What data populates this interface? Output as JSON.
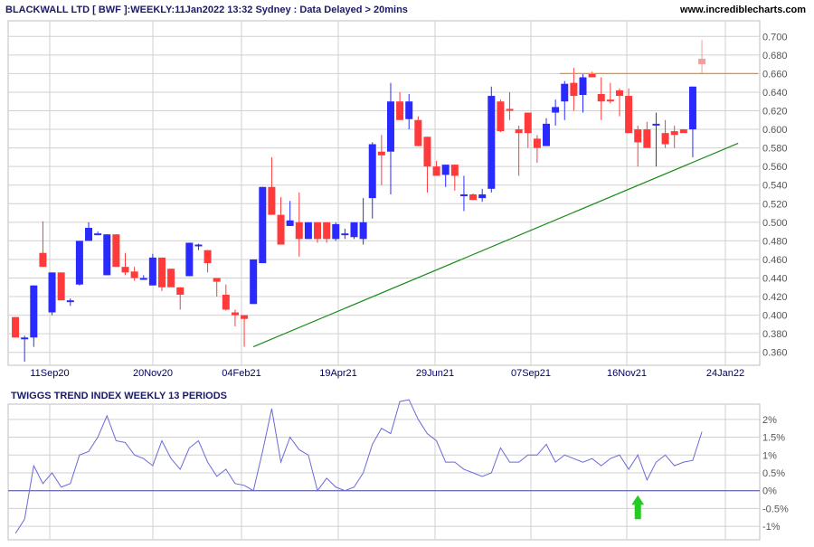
{
  "header": {
    "title": "BLACKWALL LTD [ BWF ]:WEEKLY:11Jan2022 13:32 Sydney : Data Delayed > 20mins",
    "site": "www.incrediblecharts.com"
  },
  "colors": {
    "background": "#ffffff",
    "grid": "#d0d0d0",
    "up_candle": "#2a2aff",
    "down_candle": "#ff3a3a",
    "projected_candle": "#f0a0a0",
    "resistance_line": "#ff8c00",
    "trend_line": "#1a8c1a",
    "indicator_line": "#6a6ad8",
    "zero_line": "#4a4aa0",
    "arrow": "#22cc22",
    "axis_text": "#555555"
  },
  "chart_data": [
    {
      "type": "candlestick",
      "x_tick_labels": [
        "11Sep20",
        "20Nov20",
        "04Feb21",
        "19Apr21",
        "29Jun21",
        "07Sep21",
        "16Nov21",
        "24Jan22"
      ],
      "y_tick_labels": [
        "0.700",
        "0.680",
        "0.660",
        "0.640",
        "0.620",
        "0.600",
        "0.580",
        "0.560",
        "0.540",
        "0.520",
        "0.500",
        "0.480",
        "0.460",
        "0.440",
        "0.420",
        "0.400",
        "0.380",
        "0.360"
      ],
      "ylim": [
        0.35,
        0.71
      ],
      "grid": true,
      "candles": [
        {
          "o": 0.398,
          "h": 0.398,
          "l": 0.376,
          "c": 0.376
        },
        {
          "o": 0.376,
          "h": 0.378,
          "l": 0.35,
          "c": 0.376
        },
        {
          "o": 0.376,
          "h": 0.432,
          "l": 0.366,
          "c": 0.432
        },
        {
          "o": 0.467,
          "h": 0.501,
          "l": 0.452,
          "c": 0.452
        },
        {
          "o": 0.403,
          "h": 0.446,
          "l": 0.4,
          "c": 0.446
        },
        {
          "o": 0.446,
          "h": 0.446,
          "l": 0.416,
          "c": 0.416
        },
        {
          "o": 0.416,
          "h": 0.418,
          "l": 0.41,
          "c": 0.416
        },
        {
          "o": 0.433,
          "h": 0.48,
          "l": 0.432,
          "c": 0.48
        },
        {
          "o": 0.48,
          "h": 0.5,
          "l": 0.48,
          "c": 0.494
        },
        {
          "o": 0.488,
          "h": 0.49,
          "l": 0.488,
          "c": 0.488
        },
        {
          "o": 0.443,
          "h": 0.487,
          "l": 0.443,
          "c": 0.487
        },
        {
          "o": 0.487,
          "h": 0.487,
          "l": 0.452,
          "c": 0.452
        },
        {
          "o": 0.452,
          "h": 0.467,
          "l": 0.443,
          "c": 0.446
        },
        {
          "o": 0.447,
          "h": 0.452,
          "l": 0.437,
          "c": 0.44
        },
        {
          "o": 0.44,
          "h": 0.443,
          "l": 0.44,
          "c": 0.44
        },
        {
          "o": 0.432,
          "h": 0.466,
          "l": 0.432,
          "c": 0.462
        },
        {
          "o": 0.462,
          "h": 0.462,
          "l": 0.426,
          "c": 0.43
        },
        {
          "o": 0.45,
          "h": 0.45,
          "l": 0.43,
          "c": 0.43
        },
        {
          "o": 0.43,
          "h": 0.43,
          "l": 0.406,
          "c": 0.422
        },
        {
          "o": 0.442,
          "h": 0.478,
          "l": 0.442,
          "c": 0.478
        },
        {
          "o": 0.476,
          "h": 0.477,
          "l": 0.47,
          "c": 0.476
        },
        {
          "o": 0.47,
          "h": 0.47,
          "l": 0.446,
          "c": 0.456
        },
        {
          "o": 0.44,
          "h": 0.44,
          "l": 0.42,
          "c": 0.436
        },
        {
          "o": 0.422,
          "h": 0.433,
          "l": 0.405,
          "c": 0.406
        },
        {
          "o": 0.403,
          "h": 0.406,
          "l": 0.388,
          "c": 0.4
        },
        {
          "o": 0.4,
          "h": 0.4,
          "l": 0.366,
          "c": 0.396
        },
        {
          "o": 0.412,
          "h": 0.46,
          "l": 0.412,
          "c": 0.46
        },
        {
          "o": 0.456,
          "h": 0.538,
          "l": 0.456,
          "c": 0.538
        },
        {
          "o": 0.538,
          "h": 0.57,
          "l": 0.508,
          "c": 0.508
        },
        {
          "o": 0.508,
          "h": 0.527,
          "l": 0.476,
          "c": 0.476
        },
        {
          "o": 0.496,
          "h": 0.523,
          "l": 0.496,
          "c": 0.502
        },
        {
          "o": 0.5,
          "h": 0.532,
          "l": 0.463,
          "c": 0.482
        },
        {
          "o": 0.482,
          "h": 0.5,
          "l": 0.482,
          "c": 0.5
        },
        {
          "o": 0.5,
          "h": 0.5,
          "l": 0.478,
          "c": 0.482
        },
        {
          "o": 0.5,
          "h": 0.5,
          "l": 0.478,
          "c": 0.482
        },
        {
          "o": 0.482,
          "h": 0.5,
          "l": 0.48,
          "c": 0.498
        },
        {
          "o": 0.488,
          "h": 0.493,
          "l": 0.482,
          "c": 0.488
        },
        {
          "o": 0.484,
          "h": 0.5,
          "l": 0.482,
          "c": 0.5
        },
        {
          "o": 0.482,
          "h": 0.526,
          "l": 0.476,
          "c": 0.5
        },
        {
          "o": 0.526,
          "h": 0.586,
          "l": 0.504,
          "c": 0.584
        },
        {
          "o": 0.576,
          "h": 0.594,
          "l": 0.54,
          "c": 0.572
        },
        {
          "o": 0.576,
          "h": 0.65,
          "l": 0.53,
          "c": 0.63
        },
        {
          "o": 0.63,
          "h": 0.64,
          "l": 0.614,
          "c": 0.61
        },
        {
          "o": 0.611,
          "h": 0.638,
          "l": 0.6,
          "c": 0.63
        },
        {
          "o": 0.61,
          "h": 0.614,
          "l": 0.582,
          "c": 0.582
        },
        {
          "o": 0.592,
          "h": 0.592,
          "l": 0.532,
          "c": 0.56
        },
        {
          "o": 0.56,
          "h": 0.566,
          "l": 0.55,
          "c": 0.55
        },
        {
          "o": 0.551,
          "h": 0.558,
          "l": 0.538,
          "c": 0.562
        },
        {
          "o": 0.562,
          "h": 0.562,
          "l": 0.534,
          "c": 0.55
        },
        {
          "o": 0.53,
          "h": 0.55,
          "l": 0.512,
          "c": 0.53
        },
        {
          "o": 0.53,
          "h": 0.531,
          "l": 0.524,
          "c": 0.524
        },
        {
          "o": 0.526,
          "h": 0.536,
          "l": 0.522,
          "c": 0.53
        },
        {
          "o": 0.536,
          "h": 0.646,
          "l": 0.532,
          "c": 0.636
        },
        {
          "o": 0.63,
          "h": 0.632,
          "l": 0.597,
          "c": 0.598
        },
        {
          "o": 0.622,
          "h": 0.64,
          "l": 0.61,
          "c": 0.62
        },
        {
          "o": 0.6,
          "h": 0.604,
          "l": 0.55,
          "c": 0.596
        },
        {
          "o": 0.618,
          "h": 0.618,
          "l": 0.58,
          "c": 0.596
        },
        {
          "o": 0.59,
          "h": 0.594,
          "l": 0.564,
          "c": 0.58
        },
        {
          "o": 0.582,
          "h": 0.612,
          "l": 0.582,
          "c": 0.606
        },
        {
          "o": 0.618,
          "h": 0.632,
          "l": 0.604,
          "c": 0.624
        },
        {
          "o": 0.63,
          "h": 0.652,
          "l": 0.61,
          "c": 0.649
        },
        {
          "o": 0.65,
          "h": 0.666,
          "l": 0.62,
          "c": 0.636
        },
        {
          "o": 0.637,
          "h": 0.66,
          "l": 0.618,
          "c": 0.656
        },
        {
          "o": 0.66,
          "h": 0.662,
          "l": 0.656,
          "c": 0.656
        },
        {
          "o": 0.638,
          "h": 0.656,
          "l": 0.61,
          "c": 0.63
        },
        {
          "o": 0.632,
          "h": 0.65,
          "l": 0.628,
          "c": 0.63
        },
        {
          "o": 0.642,
          "h": 0.644,
          "l": 0.614,
          "c": 0.636
        },
        {
          "o": 0.636,
          "h": 0.644,
          "l": 0.596,
          "c": 0.596
        },
        {
          "o": 0.6,
          "h": 0.604,
          "l": 0.56,
          "c": 0.586
        },
        {
          "o": 0.6,
          "h": 0.608,
          "l": 0.58,
          "c": 0.58
        },
        {
          "o": 0.606,
          "h": 0.618,
          "l": 0.56,
          "c": 0.606
        },
        {
          "o": 0.596,
          "h": 0.61,
          "l": 0.58,
          "c": 0.584
        },
        {
          "o": 0.598,
          "h": 0.604,
          "l": 0.58,
          "c": 0.594
        },
        {
          "o": 0.6,
          "h": 0.6,
          "l": 0.598,
          "c": 0.596
        },
        {
          "o": 0.6,
          "h": 0.646,
          "l": 0.57,
          "c": 0.646
        }
      ],
      "projected_candle": {
        "o": 0.676,
        "h": 0.696,
        "l": 0.66,
        "c": 0.67
      },
      "resistance_level": 0.66,
      "trend_line": [
        {
          "candle": 25,
          "value": 0.366
        },
        {
          "candle": 76,
          "value": 0.585
        }
      ]
    },
    {
      "type": "line",
      "title": "TWIGGS TREND INDEX WEEKLY 13 PERIODS",
      "y_tick_labels": [
        "2%",
        "1.5%",
        "1%",
        "0.5%",
        "0%",
        "-0.5%",
        "-1%"
      ],
      "ylim": [
        -1.25,
        2.3
      ],
      "grid": true,
      "zero_line": 0,
      "marker": {
        "type": "up-arrow",
        "candle": 68
      },
      "values": [
        -1.2,
        -0.8,
        0.7,
        0.2,
        0.5,
        0.1,
        0.2,
        1.0,
        1.1,
        1.5,
        2.1,
        1.4,
        1.35,
        1.0,
        0.9,
        0.7,
        1.4,
        0.9,
        0.6,
        1.2,
        1.4,
        0.8,
        0.4,
        0.6,
        0.2,
        0.15,
        0.0,
        1.1,
        2.3,
        0.8,
        1.5,
        1.15,
        1.0,
        0.0,
        0.35,
        0.1,
        0.0,
        0.1,
        0.5,
        1.3,
        1.75,
        1.6,
        2.5,
        2.55,
        2.0,
        1.6,
        1.4,
        0.8,
        0.8,
        0.6,
        0.5,
        0.4,
        0.5,
        1.2,
        0.8,
        0.8,
        1.0,
        1.0,
        1.3,
        0.8,
        1.0,
        0.9,
        0.8,
        0.9,
        0.7,
        0.9,
        1.0,
        0.6,
        1.0,
        0.3,
        0.8,
        1.0,
        0.7,
        0.8,
        0.85,
        1.65
      ]
    }
  ]
}
